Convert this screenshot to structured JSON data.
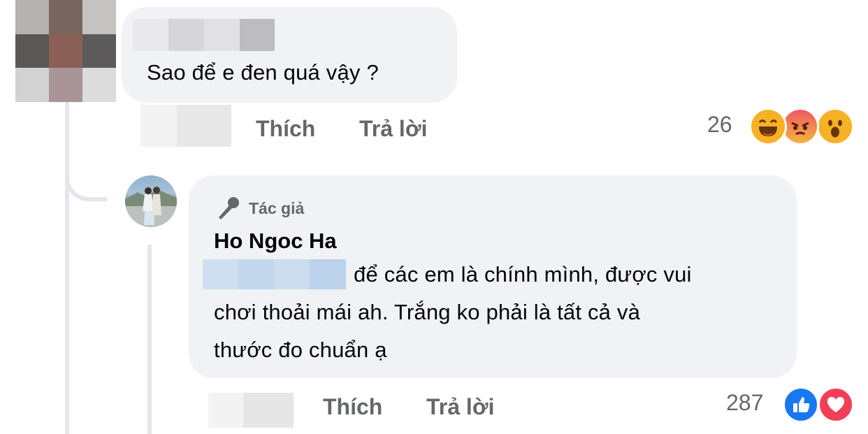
{
  "comment1": {
    "text": "Sao để e đen quá vậy ?",
    "actions": {
      "like": "Thích",
      "reply": "Trả lời"
    },
    "reaction_count": "26",
    "reactions": [
      "haha-icon",
      "angry-icon",
      "wow-icon"
    ]
  },
  "reply1": {
    "badge": "Tác giả",
    "author": "Ho Ngoc Ha",
    "text_line1": "để các em là chính mình, được vui",
    "text_line2": "chơi thoải mái ah. Trắng ko phải là tất cả và",
    "text_line3": "thước đo chuẩn ạ",
    "actions": {
      "like": "Thích",
      "reply": "Trả lời"
    },
    "reaction_count": "287",
    "reactions": [
      "like-icon",
      "love-icon"
    ]
  },
  "colors": {
    "bubble": "#f0f2f5",
    "secondary_text": "#65676b",
    "like_blue": "#1877f2",
    "love_red": "#f33e58",
    "emoji_yellow": "#f7b125"
  }
}
